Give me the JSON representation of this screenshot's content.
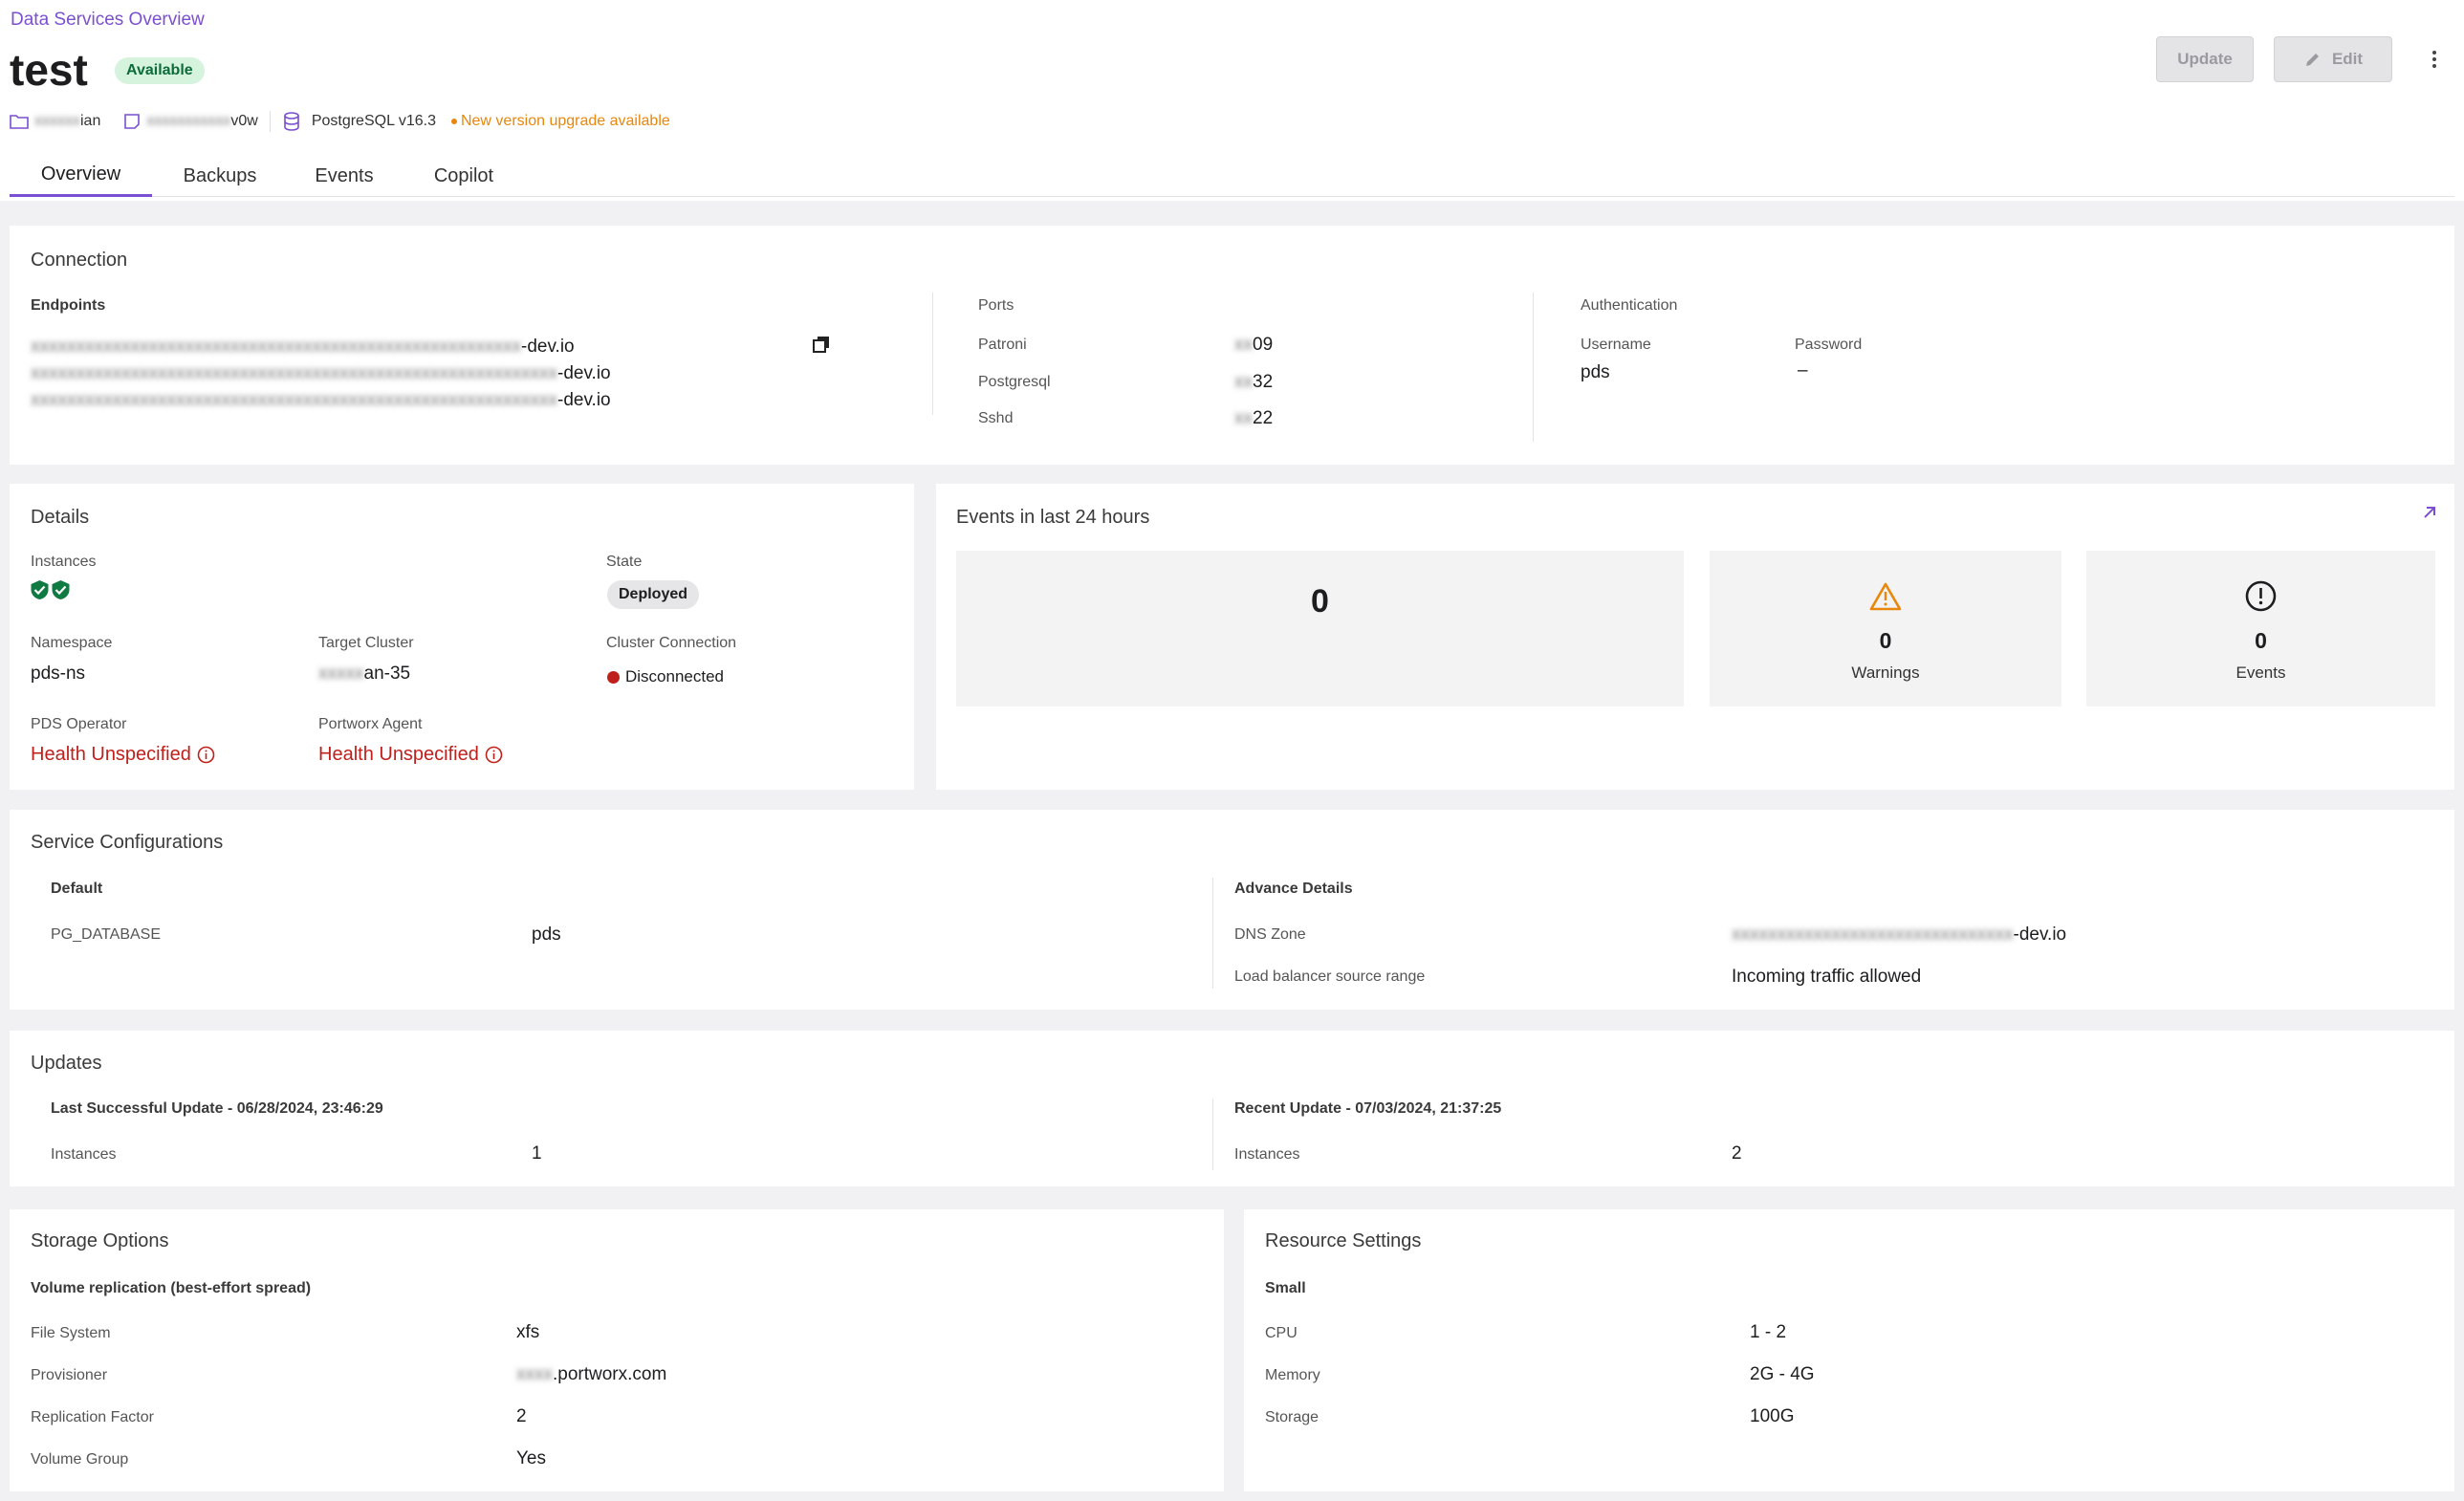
{
  "header": {
    "breadcrumb": "Data Services Overview",
    "title": "test",
    "status_badge": "Available",
    "meta": {
      "project_blurred": "xxxxxx",
      "project_suffix": "ian",
      "target_blurred": "xxxxxxxxxxx",
      "target_suffix": "v0w",
      "db_version": "PostgreSQL v16.3",
      "upgrade_notice": "New version upgrade available"
    },
    "actions": {
      "update_label": "Update",
      "edit_label": "Edit",
      "more_icon": "kebab-vertical-icon"
    },
    "tabs": [
      {
        "label": "Overview",
        "active": true
      },
      {
        "label": "Backups",
        "active": false
      },
      {
        "label": "Events",
        "active": false
      },
      {
        "label": "Copilot",
        "active": false
      }
    ]
  },
  "connection": {
    "title": "Connection",
    "endpoints_label": "Endpoints",
    "endpoints": [
      {
        "blurred": "xxxxxxxxxxxxxxxxxxxxxxxxxxxxxxxxxxxxxxxxxxxxxxxxxxxxxx",
        "suffix": "-dev.io"
      },
      {
        "blurred": "xxxxxxxxxxxxxxxxxxxxxxxxxxxxxxxxxxxxxxxxxxxxxxxxxxxxxxxxxx",
        "suffix": "-dev.io"
      },
      {
        "blurred": "xxxxxxxxxxxxxxxxxxxxxxxxxxxxxxxxxxxxxxxxxxxxxxxxxxxxxxxxxx",
        "suffix": "-dev.io"
      }
    ],
    "copy_icon": "copy-icon",
    "ports_label": "Ports",
    "ports": [
      {
        "name": "Patroni",
        "blurred": "xx",
        "suffix": "09"
      },
      {
        "name": "Postgresql",
        "blurred": "xx",
        "suffix": "32"
      },
      {
        "name": "Sshd",
        "blurred": "xx",
        "suffix": "22"
      }
    ],
    "auth_label": "Authentication",
    "username_label": "Username",
    "username": "pds",
    "password_label": "Password",
    "password": "–"
  },
  "details": {
    "title": "Details",
    "instances_label": "Instances",
    "instance_icon": "check-shield-icon",
    "state_label": "State",
    "state": "Deployed",
    "namespace_label": "Namespace",
    "namespace": "pds-ns",
    "target_cluster_label": "Target Cluster",
    "target_cluster_blurred": "xxxxx",
    "target_cluster_suffix": "an-35",
    "cluster_connection_label": "Cluster Connection",
    "cluster_connection": "Disconnected",
    "pds_operator_label": "PDS Operator",
    "pds_operator": "Health Unspecified",
    "portworx_agent_label": "Portworx Agent",
    "portworx_agent": "Health Unspecified"
  },
  "events24": {
    "title": "Events in last 24 hours",
    "total": "0",
    "warnings_count": "0",
    "warnings_label": "Warnings",
    "events_count": "0",
    "events_label": "Events"
  },
  "service_config": {
    "title": "Service Configurations",
    "default_label": "Default",
    "pg_database_label": "PG_DATABASE",
    "pg_database": "pds",
    "advance_label": "Advance Details",
    "dns_zone_label": "DNS Zone",
    "dns_zone_blurred": "xxxxxxxxxxxxxxxxxxxxxxxxxxxxxxx",
    "dns_zone_suffix": "-dev.io",
    "lb_label": "Load balancer source range",
    "lb_value": "Incoming traffic allowed"
  },
  "updates": {
    "title": "Updates",
    "last_success": "Last Successful Update - 06/28/2024, 23:46:29",
    "last_instances_label": "Instances",
    "last_instances": "1",
    "recent": "Recent Update - 07/03/2024, 21:37:25",
    "recent_instances_label": "Instances",
    "recent_instances": "2"
  },
  "storage": {
    "title": "Storage Options",
    "subtitle": "Volume replication (best-effort spread)",
    "rows": [
      {
        "label": "File System",
        "value": "xfs",
        "blurred": ""
      },
      {
        "label": "Provisioner",
        "value": ".portworx.com",
        "blurred": "xxxx"
      },
      {
        "label": "Replication Factor",
        "value": "2",
        "blurred": ""
      },
      {
        "label": "Volume Group",
        "value": "Yes",
        "blurred": ""
      }
    ]
  },
  "resources": {
    "title": "Resource Settings",
    "subtitle": "Small",
    "rows": [
      {
        "label": "CPU",
        "value": "1 - 2"
      },
      {
        "label": "Memory",
        "value": "2G - 4G"
      },
      {
        "label": "Storage",
        "value": "100G"
      }
    ]
  },
  "colors": {
    "accent": "#7b4fd1",
    "success": "#0f7b43",
    "danger": "#c0201c",
    "warning": "#e8870b"
  }
}
